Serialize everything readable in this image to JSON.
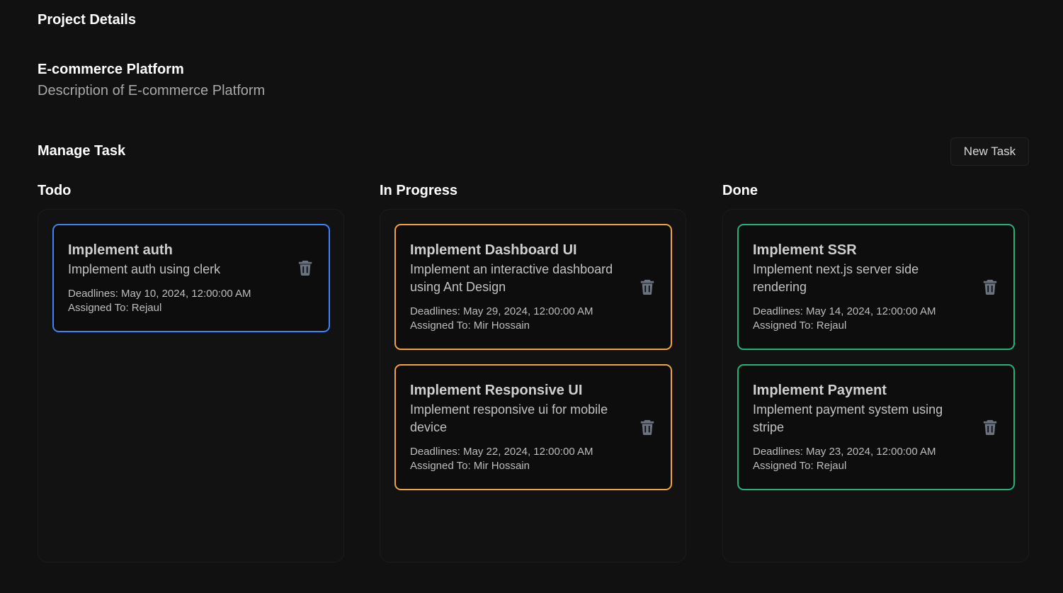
{
  "header": {
    "title": "Project Details"
  },
  "project": {
    "name": "E-commerce Platform",
    "description": "Description of E-commerce Platform"
  },
  "manage": {
    "title": "Manage Task",
    "new_task_label": "New Task"
  },
  "columns": {
    "todo": {
      "title": "Todo",
      "color": "#3f82f5",
      "cards": [
        {
          "title": "Implement auth",
          "description": "Implement auth using clerk",
          "deadline": "Deadlines: May 10, 2024, 12:00:00 AM",
          "assigned": "Assigned To: Rejaul"
        }
      ]
    },
    "progress": {
      "title": "In Progress",
      "color": "#f2a33a",
      "cards": [
        {
          "title": "Implement Dashboard UI",
          "description": "Implement an interactive dashboard using Ant Design",
          "deadline": "Deadlines: May 29, 2024, 12:00:00 AM",
          "assigned": "Assigned To: Mir Hossain"
        },
        {
          "title": "Implement Responsive UI",
          "description": "Implement responsive ui for mobile device",
          "deadline": "Deadlines: May 22, 2024, 12:00:00 AM",
          "assigned": "Assigned To: Mir Hossain"
        }
      ]
    },
    "done": {
      "title": "Done",
      "color": "#22b37a",
      "cards": [
        {
          "title": "Implement SSR",
          "description": "Implement next.js server side rendering",
          "deadline": "Deadlines: May 14, 2024, 12:00:00 AM",
          "assigned": "Assigned To: Rejaul"
        },
        {
          "title": "Implement Payment",
          "description": "Implement payment system using stripe",
          "deadline": "Deadlines: May 23, 2024, 12:00:00 AM",
          "assigned": "Assigned To: Rejaul"
        }
      ]
    }
  },
  "icons": {
    "delete": "trash-icon"
  }
}
